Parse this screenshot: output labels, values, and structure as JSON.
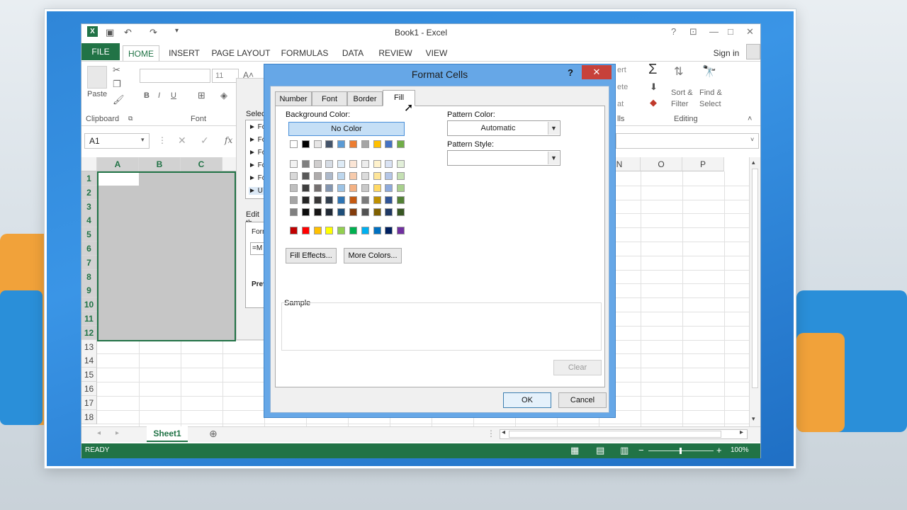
{
  "window": {
    "title": "Book1 - Excel",
    "sign_in": "Sign in"
  },
  "ribbon": {
    "tabs": [
      "FILE",
      "HOME",
      "INSERT",
      "PAGE LAYOUT",
      "FORMULAS",
      "DATA",
      "REVIEW",
      "VIEW"
    ],
    "active_tab": "HOME",
    "clipboard_group": "Clipboard",
    "paste_label": "Paste",
    "font_group": "Font",
    "font_size": "11",
    "editing_group": "Editing",
    "sort_filter": "Sort &",
    "sort_filter2": "Filter",
    "find_select": "Find &",
    "find_select2": "Select",
    "cells_group_partial": "lls",
    "insert_partial": "ert",
    "delete_partial": "ete",
    "format_partial": "at"
  },
  "formula_bar": {
    "name_box": "A1",
    "fx": "fx"
  },
  "grid": {
    "columns": [
      "A",
      "B",
      "C",
      "",
      "",
      "",
      "",
      "",
      "",
      "",
      "",
      "M",
      "N",
      "O",
      "P"
    ],
    "rows": [
      "1",
      "2",
      "3",
      "4",
      "5",
      "6",
      "7",
      "8",
      "9",
      "10",
      "11",
      "12",
      "13",
      "14",
      "15",
      "16",
      "17",
      "18"
    ]
  },
  "side_panel": {
    "select_label": "Select",
    "items": [
      "Fo",
      "Fo",
      "Fo",
      "Fo",
      "Fo",
      "U"
    ],
    "edit_label": "Edit th",
    "format_label": "Form",
    "formula_value": "=M",
    "preview_label": "Prev"
  },
  "sheet_tabs": {
    "active": "Sheet1"
  },
  "status": {
    "ready": "READY",
    "zoom": "100%"
  },
  "dialog": {
    "title": "Format Cells",
    "help": "?",
    "close": "✕",
    "tabs": [
      "Number",
      "Font",
      "Border",
      "Fill"
    ],
    "active_tab": "Fill",
    "background_color_label": "Background Color:",
    "no_color": "No Color",
    "fill_effects": "Fill Effects...",
    "more_colors": "More Colors...",
    "pattern_color_label": "Pattern Color:",
    "pattern_color_value": "Automatic",
    "pattern_style_label": "Pattern Style:",
    "pattern_style_value": "",
    "sample_label": "Sample",
    "clear": "Clear",
    "ok": "OK",
    "cancel": "Cancel",
    "palette_row1": [
      "#ffffff",
      "#000000",
      "#e7e6e6",
      "#44546a",
      "#5b9bd5",
      "#ed7d31",
      "#a5a5a5",
      "#ffc000",
      "#4472c4",
      "#70ad47"
    ],
    "palette_tints": [
      [
        "#f2f2f2",
        "#7f7f7f",
        "#d0cece",
        "#d6dce4",
        "#deebf6",
        "#fbe5d5",
        "#ededed",
        "#fff2cc",
        "#d9e2f3",
        "#e2efd9"
      ],
      [
        "#d8d8d8",
        "#595959",
        "#aeabab",
        "#adb9ca",
        "#bdd7ee",
        "#f7cbac",
        "#dbdbdb",
        "#fee599",
        "#b4c6e7",
        "#c5e0b3"
      ],
      [
        "#bfbfbf",
        "#3f3f3f",
        "#757070",
        "#8496b0",
        "#9cc3e5",
        "#f4b183",
        "#c9c9c9",
        "#ffd965",
        "#8eaadb",
        "#a8d08d"
      ],
      [
        "#a5a5a5",
        "#262626",
        "#3a3838",
        "#323f4f",
        "#2e75b5",
        "#c55a11",
        "#7b7b7b",
        "#bf9000",
        "#2f5496",
        "#538135"
      ],
      [
        "#7f7f7f",
        "#0c0c0c",
        "#171616",
        "#222a35",
        "#1e4e79",
        "#833c0b",
        "#525252",
        "#7f6000",
        "#1f3864",
        "#375623"
      ]
    ],
    "palette_standard": [
      "#c00000",
      "#ff0000",
      "#ffc000",
      "#ffff00",
      "#92d050",
      "#00b050",
      "#00b0f0",
      "#0070c0",
      "#002060",
      "#7030a0"
    ]
  }
}
